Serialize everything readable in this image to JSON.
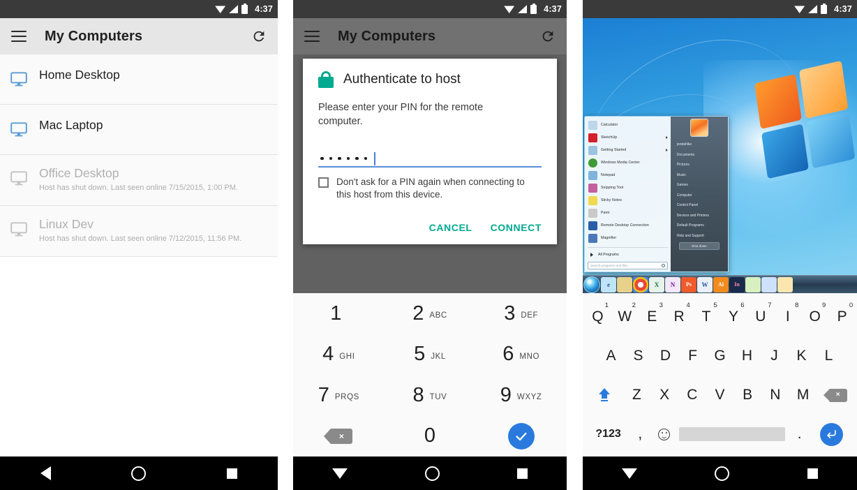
{
  "statusbar": {
    "time": "4:37",
    "wifi_icon": "wifi-icon",
    "signal_icon": "signal-icon",
    "battery_icon": "battery-icon"
  },
  "appbar": {
    "title": "My Computers",
    "menu_icon": "hamburger-menu-icon",
    "refresh_icon": "refresh-icon"
  },
  "hosts": [
    {
      "name": "Home Desktop",
      "status": "",
      "online": true
    },
    {
      "name": "Mac Laptop",
      "status": "",
      "online": true
    },
    {
      "name": "Office Desktop",
      "status": "Host has shut down. Last seen online 7/15/2015, 1:00 PM.",
      "online": false
    },
    {
      "name": "Linux Dev",
      "status": "Host has shut down. Last seen online 7/12/2015, 11:56 PM.",
      "online": false
    }
  ],
  "dialog": {
    "title": "Authenticate to host",
    "lock_icon": "lock-icon",
    "message": "Please enter your PIN for the remote computer.",
    "pin_value": "••••••",
    "pin_dot_count": 6,
    "checkbox_label": "Don't ask for a PIN again when connecting to this host from this device.",
    "checkbox_checked": false,
    "cancel_label": "CANCEL",
    "connect_label": "CONNECT",
    "accent_color": "#00a98f"
  },
  "numpad": {
    "keys": [
      {
        "num": "1",
        "letters": ""
      },
      {
        "num": "2",
        "letters": "ABC"
      },
      {
        "num": "3",
        "letters": "DEF"
      },
      {
        "num": "4",
        "letters": "GHI"
      },
      {
        "num": "5",
        "letters": "JKL"
      },
      {
        "num": "6",
        "letters": "MNO"
      },
      {
        "num": "7",
        "letters": "PRQS"
      },
      {
        "num": "8",
        "letters": "TUV"
      },
      {
        "num": "9",
        "letters": "WXYZ"
      }
    ],
    "delete_icon": "backspace-icon",
    "zero": "0",
    "confirm_icon": "checkmark-icon",
    "confirm_color": "#2a7ade"
  },
  "keyboard": {
    "row1": [
      {
        "ch": "Q",
        "sup": "1"
      },
      {
        "ch": "W",
        "sup": "2"
      },
      {
        "ch": "E",
        "sup": "3"
      },
      {
        "ch": "R",
        "sup": "4"
      },
      {
        "ch": "T",
        "sup": "5"
      },
      {
        "ch": "Y",
        "sup": "6"
      },
      {
        "ch": "U",
        "sup": "7"
      },
      {
        "ch": "I",
        "sup": "8"
      },
      {
        "ch": "O",
        "sup": "9"
      },
      {
        "ch": "P",
        "sup": "0"
      }
    ],
    "row2": [
      "A",
      "S",
      "D",
      "F",
      "G",
      "H",
      "J",
      "K",
      "L"
    ],
    "row3": [
      "Z",
      "X",
      "C",
      "V",
      "B",
      "N",
      "M"
    ],
    "shift_icon": "shift-icon",
    "backspace_icon": "backspace-icon",
    "symbols_label": "?123",
    "comma_label": ",",
    "emoji_icon": "emoji-icon",
    "space_label": "",
    "period_label": ".",
    "enter_icon": "enter-icon",
    "accent_color": "#2a7ade"
  },
  "windows": {
    "start_menu": {
      "left_items": [
        {
          "label": "Calculator",
          "arrow": false,
          "color": "#bcd6ea"
        },
        {
          "label": "SketchUp",
          "arrow": true,
          "color": "#d3202a"
        },
        {
          "label": "Getting Started",
          "arrow": true,
          "color": "#9cc3e0"
        },
        {
          "label": "Windows Media Center",
          "arrow": false,
          "color": "#3f9b35"
        },
        {
          "label": "Notepad",
          "arrow": false,
          "color": "#7fb4dd"
        },
        {
          "label": "Snipping Tool",
          "arrow": false,
          "color": "#c45fa0"
        },
        {
          "label": "Sticky Notes",
          "arrow": false,
          "color": "#f2d94e"
        },
        {
          "label": "Paint",
          "arrow": false,
          "color": "#c9c9c9"
        },
        {
          "label": "Remote Desktop Connection",
          "arrow": false,
          "color": "#2a5fa8"
        },
        {
          "label": "Magnifier",
          "arrow": false,
          "color": "#4a78b8"
        }
      ],
      "all_programs_label": "All Programs",
      "search_placeholder": "Search programs and files",
      "search_icon": "magnifier-icon",
      "right_items": [
        "jondahlke",
        "Documents",
        "Pictures",
        "Music",
        "Games",
        "Computer",
        "Control Panel",
        "Devices and Printers",
        "Default Programs",
        "Help and Support"
      ],
      "shutdown_label": "Shut down",
      "avatar_icon": "user-avatar"
    },
    "taskbar_icons": [
      {
        "name": "start-orb-icon",
        "label": "",
        "color": ""
      },
      {
        "name": "internet-explorer-icon",
        "label": "e",
        "color": "#7fc6ee"
      },
      {
        "name": "windows-explorer-icon",
        "label": "",
        "color": "#e8d18a"
      },
      {
        "name": "chrome-icon",
        "label": "",
        "color": "#e8e8e8"
      },
      {
        "name": "excel-icon",
        "label": "X",
        "color": "#217346"
      },
      {
        "name": "onenote-icon",
        "label": "N",
        "color": "#7719aa"
      },
      {
        "name": "photoshop-icon",
        "label": "Ps",
        "color": "#ef5b2b"
      },
      {
        "name": "word-icon",
        "label": "W",
        "color": "#2b579a"
      },
      {
        "name": "illustrator-icon",
        "label": "Ai",
        "color": "#f28b1e"
      },
      {
        "name": "indesign-icon",
        "label": "In",
        "color": "#1b2a4a"
      },
      {
        "name": "evernote-icon",
        "label": "",
        "color": "#7ac143"
      },
      {
        "name": "docs-icon",
        "label": "",
        "color": "#4285f4"
      },
      {
        "name": "sheets-icon",
        "label": "",
        "color": "#f4b400"
      }
    ]
  },
  "navbar": {
    "back_icon": "back-triangle-icon",
    "down_icon": "hide-keyboard-down-icon",
    "home_icon": "home-circle-icon",
    "recents_icon": "recents-square-icon"
  }
}
